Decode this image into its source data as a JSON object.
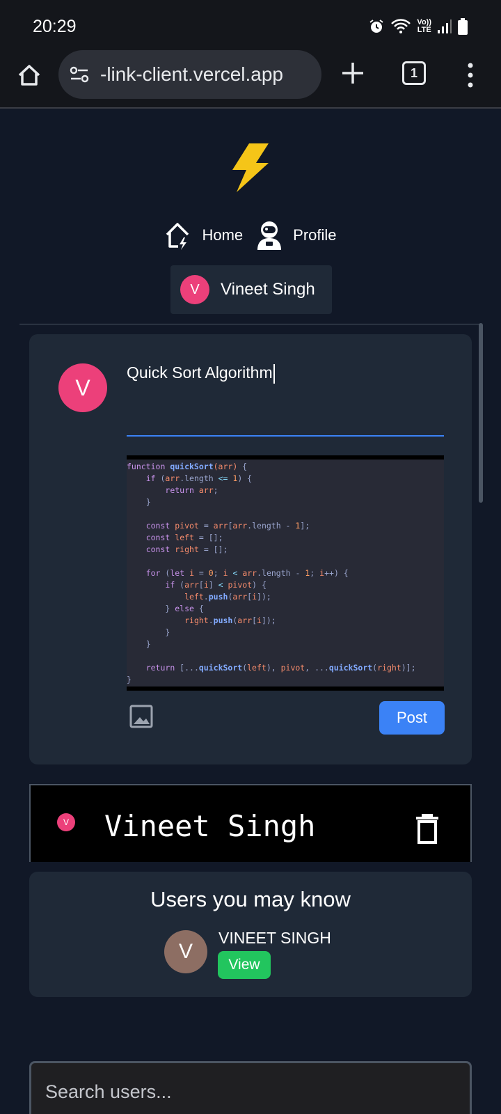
{
  "status_bar": {
    "time": "20:29",
    "network_label_top": "Vo))",
    "network_label_bottom": "LTE"
  },
  "browser": {
    "url": "-link-client.vercel.app",
    "tab_count": "1"
  },
  "nav": {
    "home_label": "Home",
    "profile_label": "Profile"
  },
  "current_user": {
    "initial": "V",
    "name": "Vineet Singh"
  },
  "composer": {
    "avatar_initial": "V",
    "input_value": "Quick Sort Algorithm",
    "post_label": "Post",
    "code_lines": [
      "function quickSort(arr) {",
      "    if (arr.length <= 1) {",
      "        return arr;",
      "    }",
      "",
      "    const pivot = arr[arr.length - 1];",
      "    const left = [];",
      "    const right = [];",
      "",
      "    for (let i = 0; i < arr.length - 1; i++) {",
      "        if (arr[i] < pivot) {",
      "            left.push(arr[i]);",
      "        } else {",
      "            right.push(arr[i]);",
      "        }",
      "    }",
      "",
      "    return [...quickSort(left), pivot, ...quickSort(right)];",
      "}"
    ]
  },
  "post": {
    "avatar_initial": "V",
    "author": "Vineet Singh"
  },
  "suggestions": {
    "title": "Users you may know",
    "users": [
      {
        "initial": "V",
        "name": "VINEET SINGH",
        "view_label": "View"
      }
    ]
  },
  "search": {
    "placeholder": "Search users..."
  },
  "colors": {
    "accent": "#3b82f6",
    "success": "#22c55e",
    "avatar_pink": "#ec407a",
    "avatar_brown": "#8d6e63",
    "bolt": "#f5c518"
  }
}
